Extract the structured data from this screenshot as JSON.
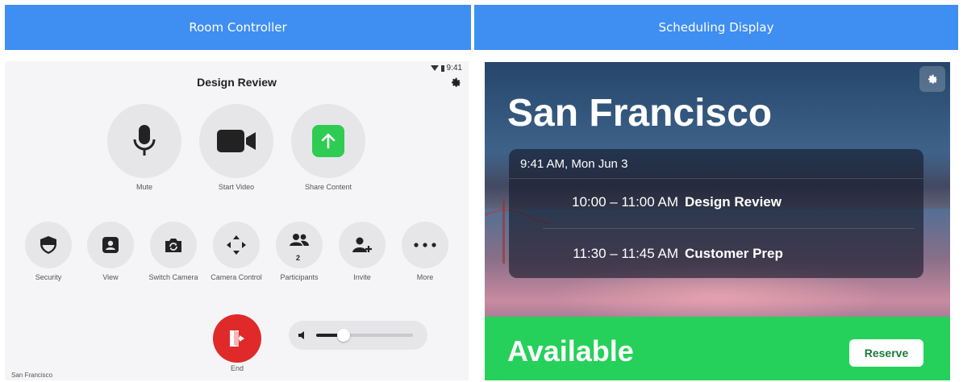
{
  "headers": {
    "left": "Room Controller",
    "right": "Scheduling Display"
  },
  "room_controller": {
    "status_time": "9:41",
    "title": "Design Review",
    "main_buttons": [
      {
        "label": "Mute",
        "icon": "microphone-icon"
      },
      {
        "label": "Start Video",
        "icon": "video-camera-icon"
      },
      {
        "label": "Share Content",
        "icon": "share-arrow-icon"
      }
    ],
    "secondary_buttons": [
      {
        "label": "Security",
        "icon": "shield-icon"
      },
      {
        "label": "View",
        "icon": "view-person-icon"
      },
      {
        "label": "Switch Camera",
        "icon": "switch-camera-icon"
      },
      {
        "label": "Camera Control",
        "icon": "move-arrows-icon"
      },
      {
        "label": "Participants",
        "icon": "people-icon",
        "count": "2"
      },
      {
        "label": "Invite",
        "icon": "add-person-icon"
      },
      {
        "label": "More",
        "icon": "more-dots-icon"
      }
    ],
    "end_label": "End",
    "volume_level": 0.28,
    "location": "San Francisco"
  },
  "scheduling_display": {
    "city": "San Francisco",
    "current_datetime": "9:41 AM, Mon Jun 3",
    "meetings": [
      {
        "time": "10:00 – 11:00 AM",
        "title": "Design Review"
      },
      {
        "time": "11:30 – 11:45 AM",
        "title": "Customer Prep"
      }
    ],
    "status": "Available",
    "reserve_label": "Reserve"
  },
  "colors": {
    "header_blue": "#3f8ef2",
    "share_green": "#2ecc52",
    "end_red": "#e02a2a",
    "available_green": "#25d15a"
  }
}
